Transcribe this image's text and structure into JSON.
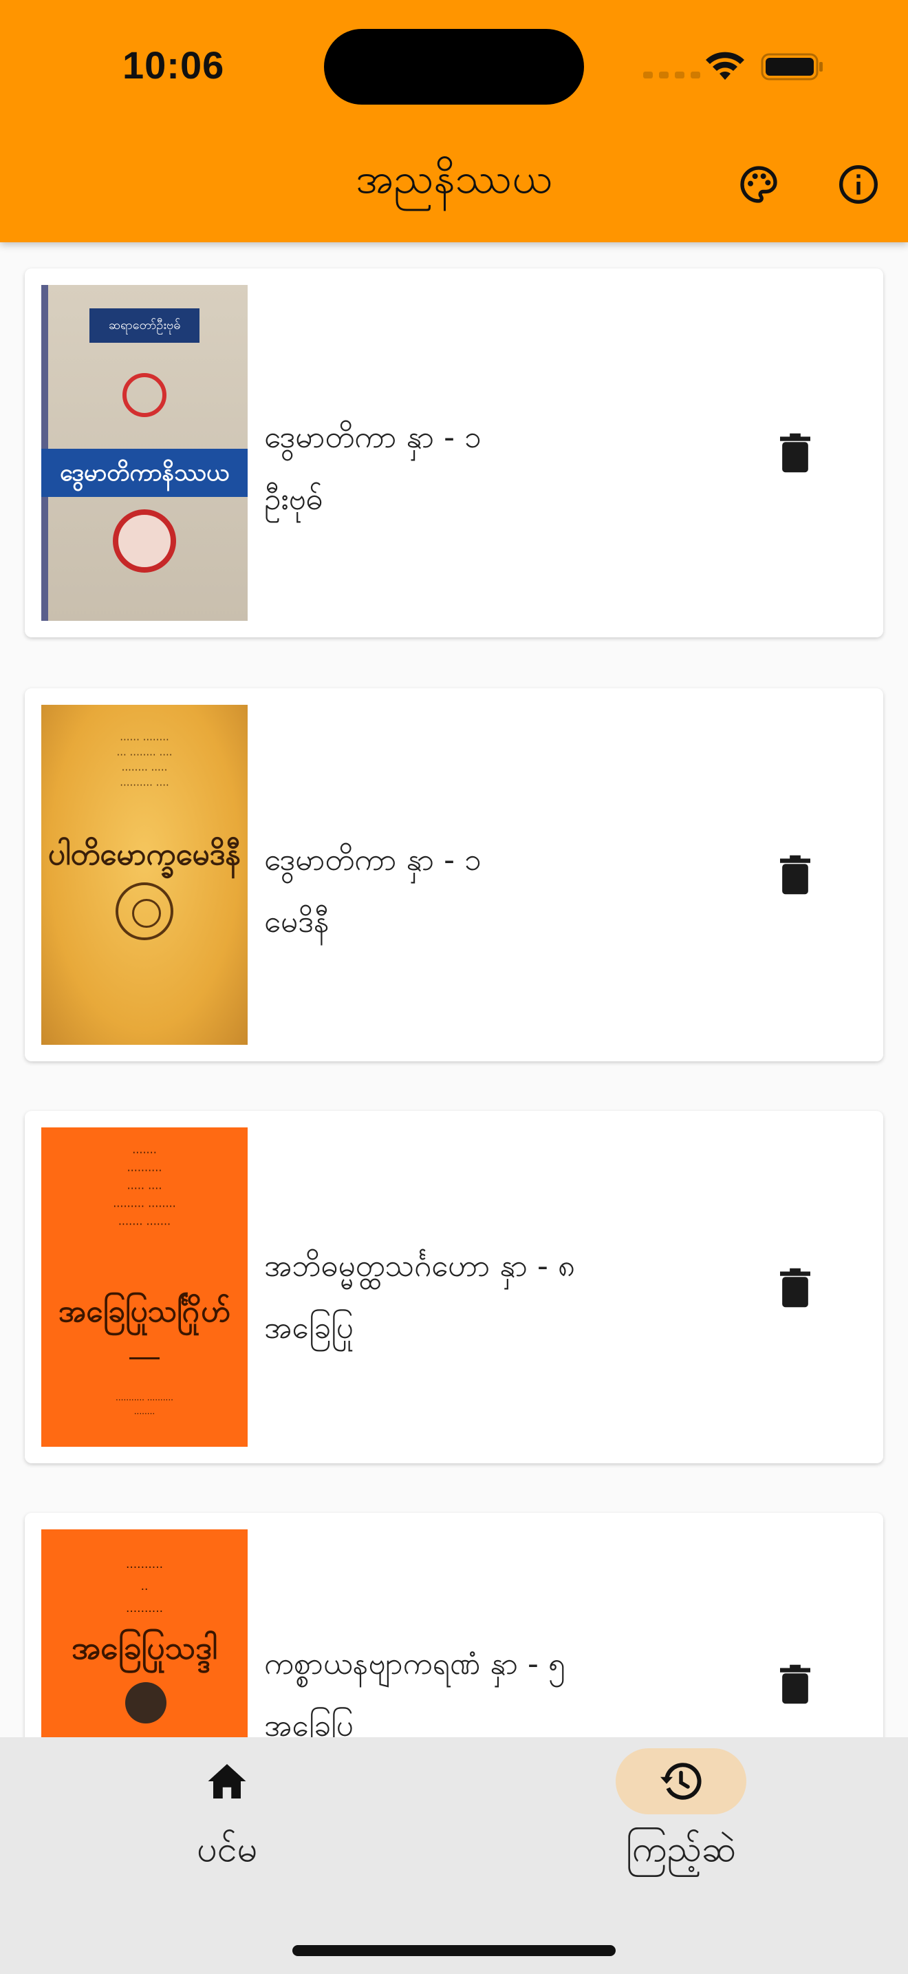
{
  "status_bar": {
    "time": "10:06"
  },
  "header": {
    "title": "အညနိဿယ"
  },
  "books": [
    {
      "title": "ဒွေမာတိကာ  နှာ - ၁",
      "author": "ဦးဗုဓ်"
    },
    {
      "title": "ဒွေမာတိကာ  နှာ - ၁",
      "author": "မေဒိနီ"
    },
    {
      "title": "အဘိဓမ္မတ္ထသင်္ဂဟော  နှာ - ၈",
      "author": "အခြေပြု"
    },
    {
      "title": "ကစ္စာယနဗျာကရဏံ  နှာ - ၅",
      "author": "အခြေပြု"
    }
  ],
  "covers": {
    "c1_banner": "ဆရာတော်ဦးဗုဓ်",
    "c1_title": "ဒွေမာတိကာနိဿယ",
    "c2_title": "ပါတိမောက္ခမေဒိနီ",
    "c3_title": "အခြေပြုသင်္ဂြိုဟ်",
    "c4_title": "အခြေပြုသဒ္ဒါ"
  },
  "bottom_nav": {
    "home_label": "ပင်မ",
    "history_label": "ကြည့်ဆဲ"
  },
  "colors": {
    "accent": "#ff9500",
    "nav_active_pill": "#f3d9b5"
  }
}
